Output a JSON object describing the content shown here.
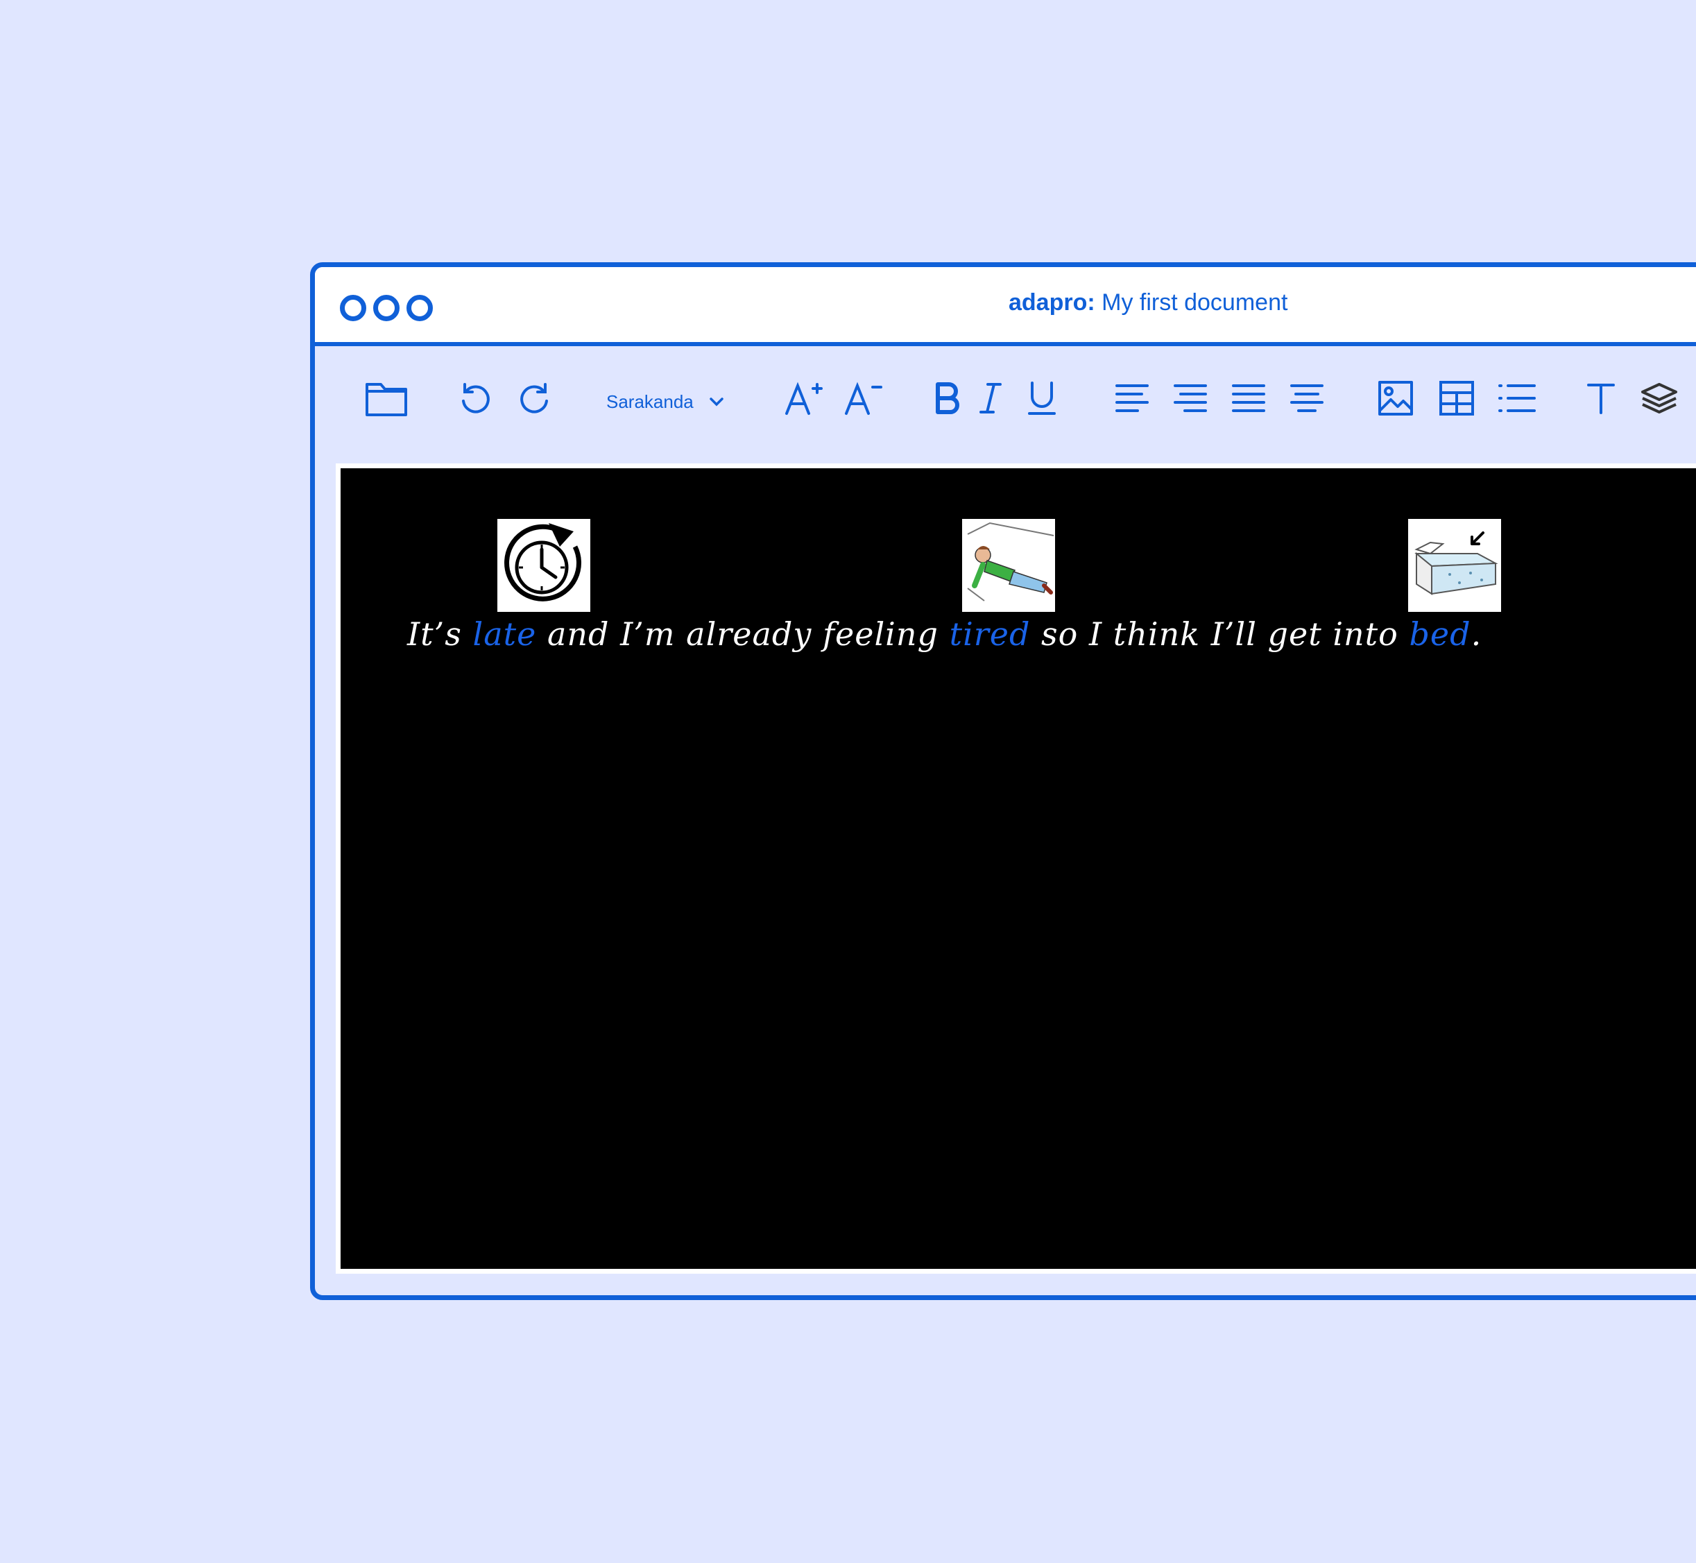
{
  "window": {
    "app_name": "adapro",
    "separator": ":",
    "doc_title": " My first document"
  },
  "toolbar": {
    "font_name": "Sarakanda",
    "icons": [
      "folder-icon",
      "undo-icon",
      "redo-icon",
      "chevron-down-icon",
      "increase-font-icon",
      "decrease-font-icon",
      "bold-icon",
      "italic-icon",
      "underline-icon",
      "align-left-icon",
      "align-right-icon",
      "align-justify-icon",
      "align-center-icon",
      "image-icon",
      "table-icon",
      "list-icon",
      "text-icon",
      "layers-icon"
    ]
  },
  "document": {
    "sentence": [
      {
        "text": "It’s ",
        "highlight": false
      },
      {
        "text": "late",
        "highlight": true,
        "symbol": "clock-symbol"
      },
      {
        "text": " and I’m already feeling ",
        "highlight": false
      },
      {
        "text": "tired",
        "highlight": true,
        "symbol": "tired-person-symbol"
      },
      {
        "text": " so I think I’ll get into ",
        "highlight": false
      },
      {
        "text": "bed",
        "highlight": true,
        "symbol": "bed-symbol"
      },
      {
        "text": ".",
        "highlight": false
      }
    ]
  },
  "colors": {
    "accent": "#1060d8",
    "background": "#e0e6ff",
    "canvas": "#000000",
    "highlight_word": "#1a63e8"
  }
}
